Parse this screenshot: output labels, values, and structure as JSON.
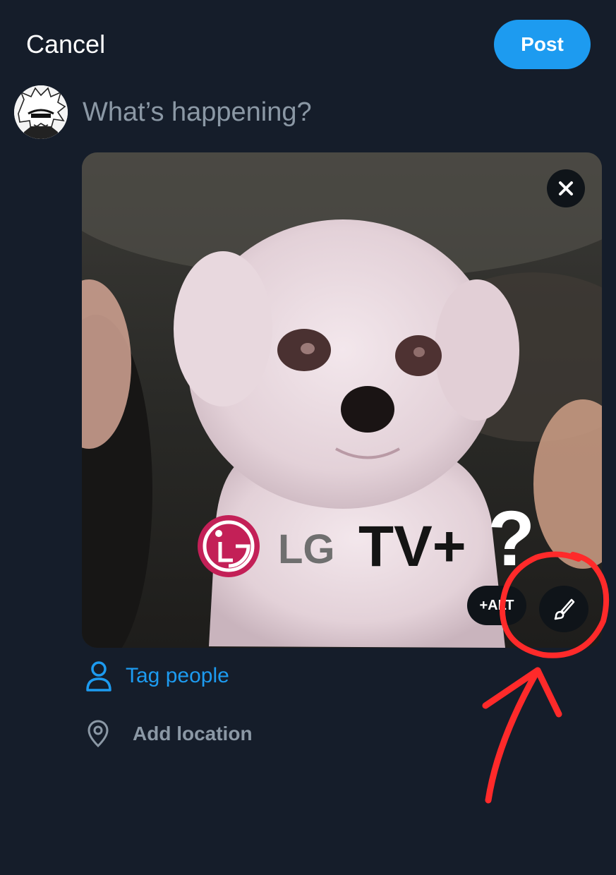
{
  "header": {
    "cancel_label": "Cancel",
    "post_label": "Post"
  },
  "composer": {
    "placeholder": "What’s happening?"
  },
  "media": {
    "logo_text_lg": "LG",
    "logo_text_tv": "TV+",
    "logo_text_q": "?",
    "alt_label": "+ALT"
  },
  "actions": {
    "tag_people_label": "Tag people",
    "add_location_label": "Add location"
  },
  "colors": {
    "background": "#151d2a",
    "accent": "#1d9bf0",
    "annotation": "#ff2a2a"
  },
  "icons": {
    "close": "close-icon",
    "edit": "paintbrush-icon",
    "tag": "person-icon",
    "location": "location-pin-icon"
  }
}
